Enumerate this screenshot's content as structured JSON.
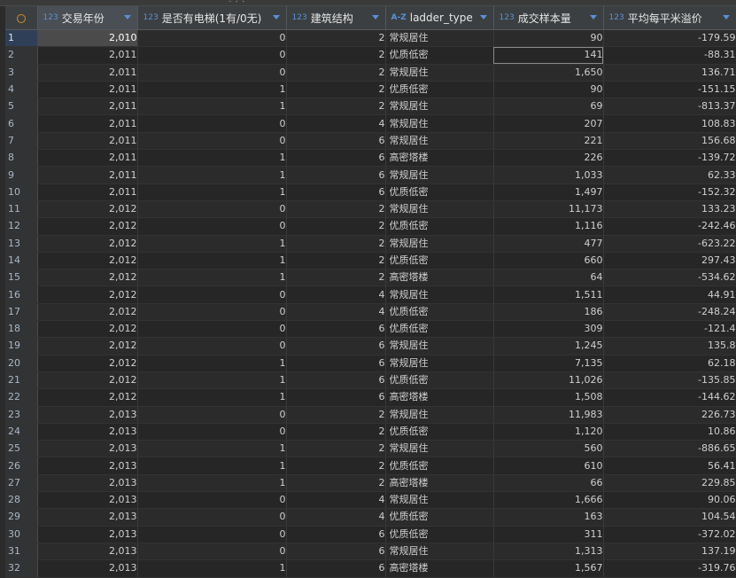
{
  "columns": [
    {
      "type": "123",
      "name": "交易年份"
    },
    {
      "type": "123",
      "name": "是否有电梯(1有/0无)"
    },
    {
      "type": "123",
      "name": "建筑结构"
    },
    {
      "type": "A-Z",
      "name": "ladder_type"
    },
    {
      "type": "123",
      "name": "成交样本量"
    },
    {
      "type": "123",
      "name": "平均每平米溢价"
    }
  ],
  "rows": [
    [
      "1",
      "2,010",
      "0",
      "2",
      "常规居住",
      "90",
      "-179.59"
    ],
    [
      "2",
      "2,011",
      "0",
      "2",
      "优质低密",
      "141",
      "-88.31"
    ],
    [
      "3",
      "2,011",
      "0",
      "2",
      "常规居住",
      "1,650",
      "136.71"
    ],
    [
      "4",
      "2,011",
      "1",
      "2",
      "优质低密",
      "90",
      "-151.15"
    ],
    [
      "5",
      "2,011",
      "1",
      "2",
      "常规居住",
      "69",
      "-813.37"
    ],
    [
      "6",
      "2,011",
      "0",
      "4",
      "常规居住",
      "207",
      "108.83"
    ],
    [
      "7",
      "2,011",
      "0",
      "6",
      "常规居住",
      "221",
      "156.68"
    ],
    [
      "8",
      "2,011",
      "1",
      "6",
      "高密塔楼",
      "226",
      "-139.72"
    ],
    [
      "9",
      "2,011",
      "1",
      "6",
      "常规居住",
      "1,033",
      "62.33"
    ],
    [
      "10",
      "2,011",
      "1",
      "6",
      "优质低密",
      "1,497",
      "-152.32"
    ],
    [
      "11",
      "2,012",
      "0",
      "2",
      "常规居住",
      "11,173",
      "133.23"
    ],
    [
      "12",
      "2,012",
      "0",
      "2",
      "优质低密",
      "1,116",
      "-242.46"
    ],
    [
      "13",
      "2,012",
      "1",
      "2",
      "常规居住",
      "477",
      "-623.22"
    ],
    [
      "14",
      "2,012",
      "1",
      "2",
      "优质低密",
      "660",
      "297.43"
    ],
    [
      "15",
      "2,012",
      "1",
      "2",
      "高密塔楼",
      "64",
      "-534.62"
    ],
    [
      "16",
      "2,012",
      "0",
      "4",
      "常规居住",
      "1,511",
      "44.91"
    ],
    [
      "17",
      "2,012",
      "0",
      "4",
      "优质低密",
      "186",
      "-248.24"
    ],
    [
      "18",
      "2,012",
      "0",
      "6",
      "优质低密",
      "309",
      "-121.4"
    ],
    [
      "19",
      "2,012",
      "0",
      "6",
      "常规居住",
      "1,245",
      "135.8"
    ],
    [
      "20",
      "2,012",
      "1",
      "6",
      "常规居住",
      "7,135",
      "62.18"
    ],
    [
      "21",
      "2,012",
      "1",
      "6",
      "优质低密",
      "11,026",
      "-135.85"
    ],
    [
      "22",
      "2,012",
      "1",
      "6",
      "高密塔楼",
      "1,508",
      "-144.62"
    ],
    [
      "23",
      "2,013",
      "0",
      "2",
      "常规居住",
      "11,983",
      "226.73"
    ],
    [
      "24",
      "2,013",
      "0",
      "2",
      "优质低密",
      "1,120",
      "10.86"
    ],
    [
      "25",
      "2,013",
      "1",
      "2",
      "常规居住",
      "560",
      "-886.65"
    ],
    [
      "26",
      "2,013",
      "1",
      "2",
      "优质低密",
      "610",
      "56.41"
    ],
    [
      "27",
      "2,013",
      "1",
      "2",
      "高密塔楼",
      "66",
      "229.85"
    ],
    [
      "28",
      "2,013",
      "0",
      "4",
      "常规居住",
      "1,666",
      "90.06"
    ],
    [
      "29",
      "2,013",
      "0",
      "4",
      "优质低密",
      "163",
      "104.54"
    ],
    [
      "30",
      "2,013",
      "0",
      "6",
      "优质低密",
      "311",
      "-372.02"
    ],
    [
      "31",
      "2,013",
      "0",
      "6",
      "常规居住",
      "1,313",
      "137.19"
    ],
    [
      "32",
      "2,013",
      "1",
      "6",
      "高密塔楼",
      "1,567",
      "-319.76"
    ]
  ]
}
